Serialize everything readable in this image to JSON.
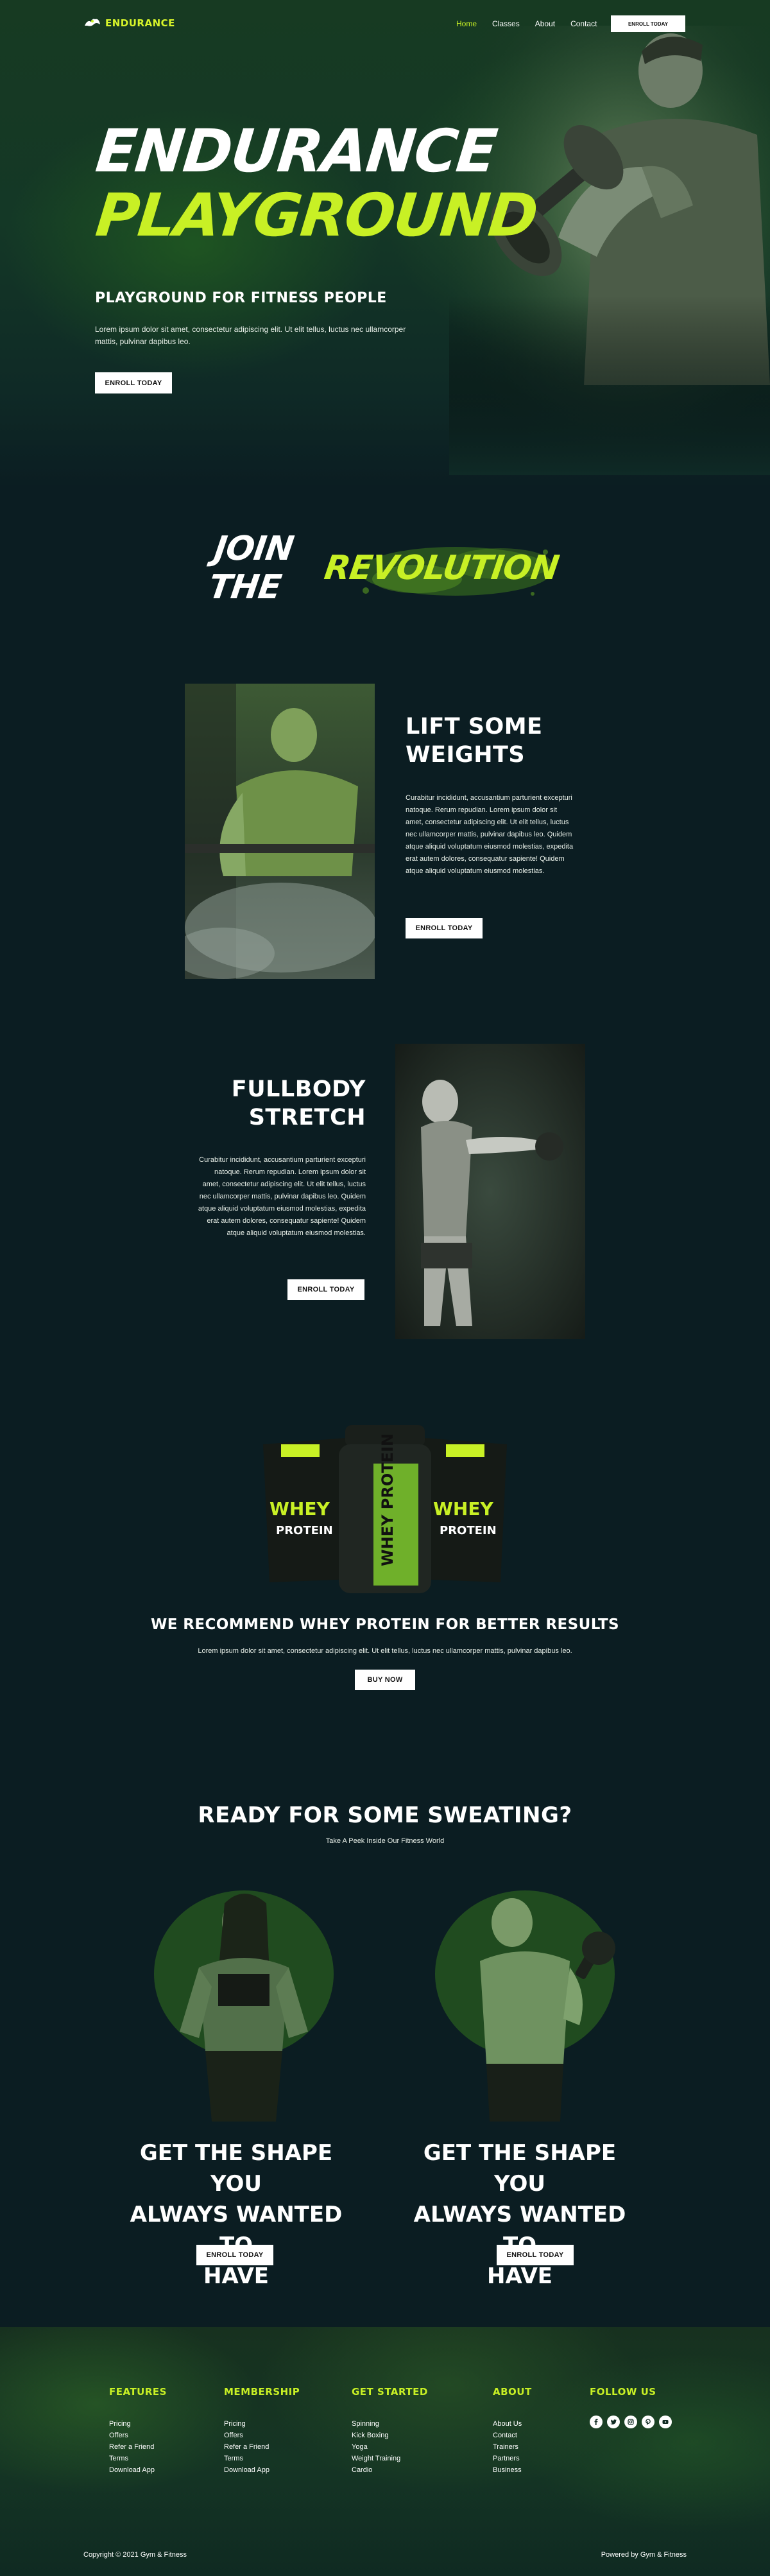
{
  "nav": {
    "logo_text": "ENDURANCE",
    "links": [
      {
        "label": "Home",
        "active": true
      },
      {
        "label": "Classes",
        "active": false
      },
      {
        "label": "About",
        "active": false
      },
      {
        "label": "Contact",
        "active": false
      }
    ],
    "enroll_label": "ENROLL TODAY"
  },
  "hero": {
    "title_line1": "ENDURANCE",
    "title_line2": "PLAYGROUND",
    "subtitle": "PLAYGROUND FOR FITNESS PEOPLE",
    "text": "Lorem ipsum dolor sit amet, consectetur adipiscing elit. Ut elit tellus, luctus nec ullamcorper mattis, pulvinar dapibus leo.",
    "button_label": "ENROLL TODAY"
  },
  "revolution": {
    "word1": "JOIN THE",
    "word2": "REVOLUTION"
  },
  "features": [
    {
      "title_line1": "LIFT SOME",
      "title_line2": "WEIGHTS",
      "text": "Curabitur incididunt, accusantium parturient excepturi natoque. Rerum repudian. Lorem ipsum dolor sit amet, consectetur adipiscing elit. Ut elit tellus, luctus nec ullamcorper mattis, pulvinar dapibus leo. Quidem atque aliquid voluptatum eiusmod molestias, expedita erat autem dolores, consequatur sapiente! Quidem atque aliquid voluptatum eiusmod molestias.",
      "button_label": "ENROLL TODAY"
    },
    {
      "title_line1": "FULLBODY",
      "title_line2": "STRETCH",
      "text": "Curabitur incididunt, accusantium parturient excepturi natoque. Rerum repudian. Lorem ipsum dolor sit amet, consectetur adipiscing elit. Ut elit tellus, luctus nec ullamcorper mattis, pulvinar dapibus leo. Quidem atque aliquid voluptatum eiusmod molestias, expedita erat autem dolores, consequatur sapiente! Quidem atque aliquid voluptatum eiusmod molestias.",
      "button_label": "ENROLL TODAY"
    }
  ],
  "protein": {
    "product_word1": "WHEY",
    "product_word2": "PROTEIN",
    "jar_label": "WHEY PROTEIN",
    "title": "WE RECOMMEND WHEY PROTEIN FOR BETTER RESULTS",
    "text": "Lorem ipsum dolor sit amet, consectetur adipiscing elit. Ut elit tellus, luctus nec ullamcorper mattis, pulvinar dapibus leo.",
    "button_label": "BUY NOW"
  },
  "sweating": {
    "title": "READY FOR SOME SWEATING?",
    "subtitle": "Take A Peek Inside Our Fitness World",
    "cards": [
      {
        "title_line1": "GET THE SHAPE YOU",
        "title_line2": "ALWAYS WANTED TO",
        "title_line3": "HAVE",
        "button_label": "ENROLL TODAY"
      },
      {
        "title_line1": "GET THE SHAPE YOU",
        "title_line2": "ALWAYS WANTED TO",
        "title_line3": "HAVE",
        "button_label": "ENROLL TODAY"
      }
    ]
  },
  "footer": {
    "columns": [
      {
        "heading": "FEATURES",
        "links": [
          "Pricing",
          "Offers",
          "Refer a Friend",
          "Terms",
          "Download App"
        ]
      },
      {
        "heading": "MEMBERSHIP",
        "links": [
          "Pricing",
          "Offers",
          "Refer a Friend",
          "Terms",
          "Download App"
        ]
      },
      {
        "heading": "GET STARTED",
        "links": [
          "Spinning",
          "Kick Boxing",
          "Yoga",
          "Weight Training",
          "Cardio"
        ]
      },
      {
        "heading": "ABOUT",
        "links": [
          "About Us",
          "Contact",
          "Trainers",
          "Partners",
          "Business"
        ]
      }
    ],
    "follow_heading": "FOLLOW US",
    "socials": [
      "facebook-icon",
      "twitter-icon",
      "instagram-icon",
      "pinterest-icon",
      "youtube-icon"
    ],
    "copyright": "Copyright © 2021 Gym & Fitness",
    "powered": "Powered by Gym & Fitness"
  },
  "colors": {
    "accent": "#c8f025",
    "background": "#0b1d22",
    "button": "#ffffff"
  }
}
